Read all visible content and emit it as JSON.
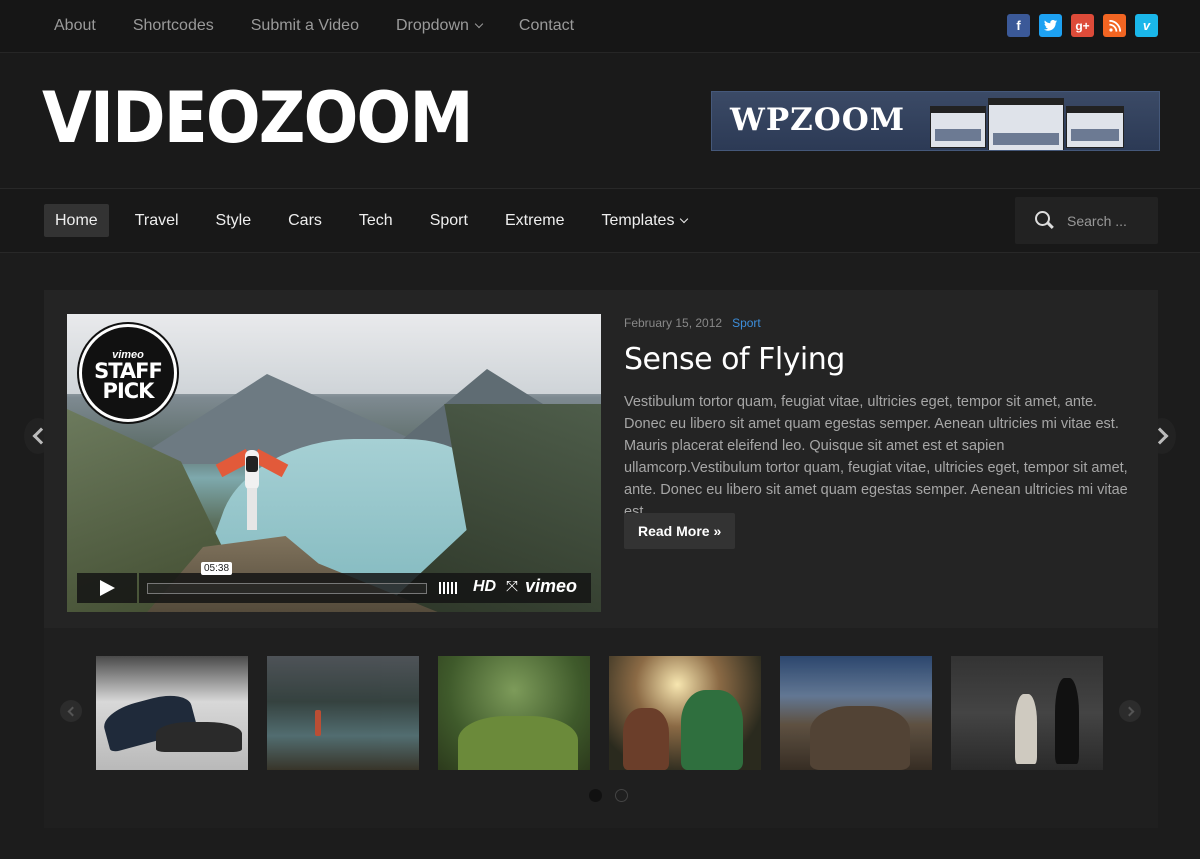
{
  "topnav": {
    "items": [
      {
        "label": "About"
      },
      {
        "label": "Shortcodes"
      },
      {
        "label": "Submit a Video"
      },
      {
        "label": "Dropdown",
        "has_dropdown": true
      },
      {
        "label": "Contact"
      }
    ]
  },
  "social": [
    {
      "name": "facebook-icon",
      "glyph": "f",
      "color": "#3b5998"
    },
    {
      "name": "twitter-icon",
      "glyph": "t",
      "color": "#1da1f2"
    },
    {
      "name": "google-plus-icon",
      "glyph": "g+",
      "color": "#dd4b39"
    },
    {
      "name": "rss-icon",
      "glyph": "r",
      "color": "#f26522"
    },
    {
      "name": "vimeo-icon",
      "glyph": "v",
      "color": "#1ab7ea"
    }
  ],
  "header": {
    "logo": "VIDEOZOOM",
    "banner_text": "WPZOOM"
  },
  "mainnav": {
    "items": [
      {
        "label": "Home",
        "active": true
      },
      {
        "label": "Travel"
      },
      {
        "label": "Style"
      },
      {
        "label": "Cars"
      },
      {
        "label": "Tech"
      },
      {
        "label": "Sport"
      },
      {
        "label": "Extreme"
      },
      {
        "label": "Templates",
        "has_dropdown": true
      }
    ],
    "search_placeholder": "Search ..."
  },
  "featured": {
    "date": "February 15, 2012",
    "category": "Sport",
    "title": "Sense of Flying",
    "excerpt": "Vestibulum tortor quam, feugiat vitae, ultricies eget, tempor sit amet, ante. Donec eu libero sit amet quam egestas semper. Aenean ultricies mi vitae est. Mauris placerat eleifend leo. Quisque sit amet est et sapien ullamcorp.Vestibulum tortor quam, feugiat vitae, ultricies eget, tempor sit amet, ante. Donec eu libero sit amet quam egestas semper. Aenean ultricies mi vitae est.",
    "read_more": "Read More »",
    "video": {
      "badge_brand": "vimeo",
      "badge_line1": "STAFF",
      "badge_line2": "PICK",
      "time": "05:38",
      "hd": "HD",
      "player_brand": "vimeo"
    }
  },
  "carousel": {
    "thumb_count": 6,
    "pages": 2,
    "active_page": 1
  },
  "colors": {
    "accent": "#3d8edb",
    "background": "#1c1c1c"
  }
}
